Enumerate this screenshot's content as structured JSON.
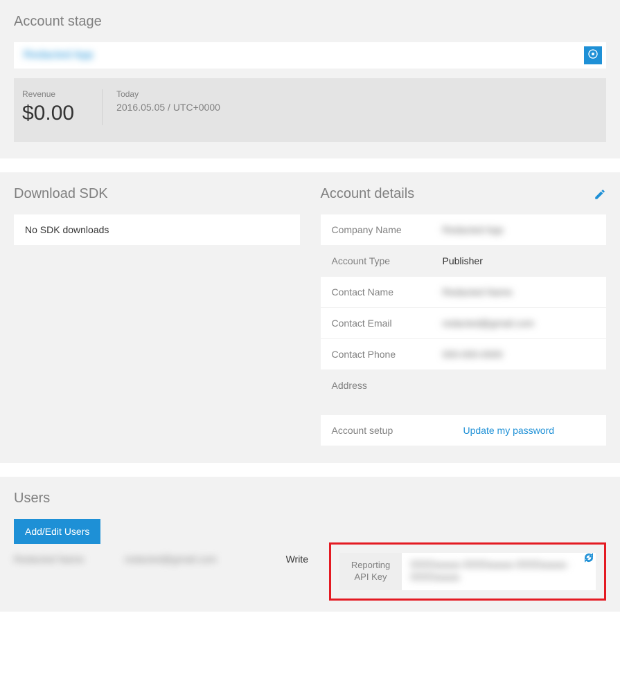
{
  "account_stage": {
    "title": "Account stage",
    "app_name": "Redacted App",
    "revenue_label": "Revenue",
    "revenue_value": "$0.00",
    "today_label": "Today",
    "today_value": "2016.05.05 / UTC+0000"
  },
  "download_sdk": {
    "title": "Download SDK",
    "empty_text": "No SDK downloads"
  },
  "account_details": {
    "title": "Account details",
    "rows": {
      "company_name_label": "Company Name",
      "company_name_value": "Redacted App",
      "account_type_label": "Account Type",
      "account_type_value": "Publisher",
      "contact_name_label": "Contact Name",
      "contact_name_value": "Redacted Name",
      "contact_email_label": "Contact Email",
      "contact_email_value": "redacted@gmail.com",
      "contact_phone_label": "Contact Phone",
      "contact_phone_value": "000-000-0000",
      "address_label": "Address",
      "setup_label": "Account setup",
      "setup_link": "Update my password"
    }
  },
  "users": {
    "title": "Users",
    "add_edit_btn": "Add/Edit Users",
    "row": {
      "name": "Redacted Name",
      "email": "redacted@gmail.com",
      "permission": "Write"
    },
    "api_key_label": "Reporting API Key",
    "api_key_value": "0000aaaa-0000aaaa-0000aaaa-0000aaaa"
  }
}
